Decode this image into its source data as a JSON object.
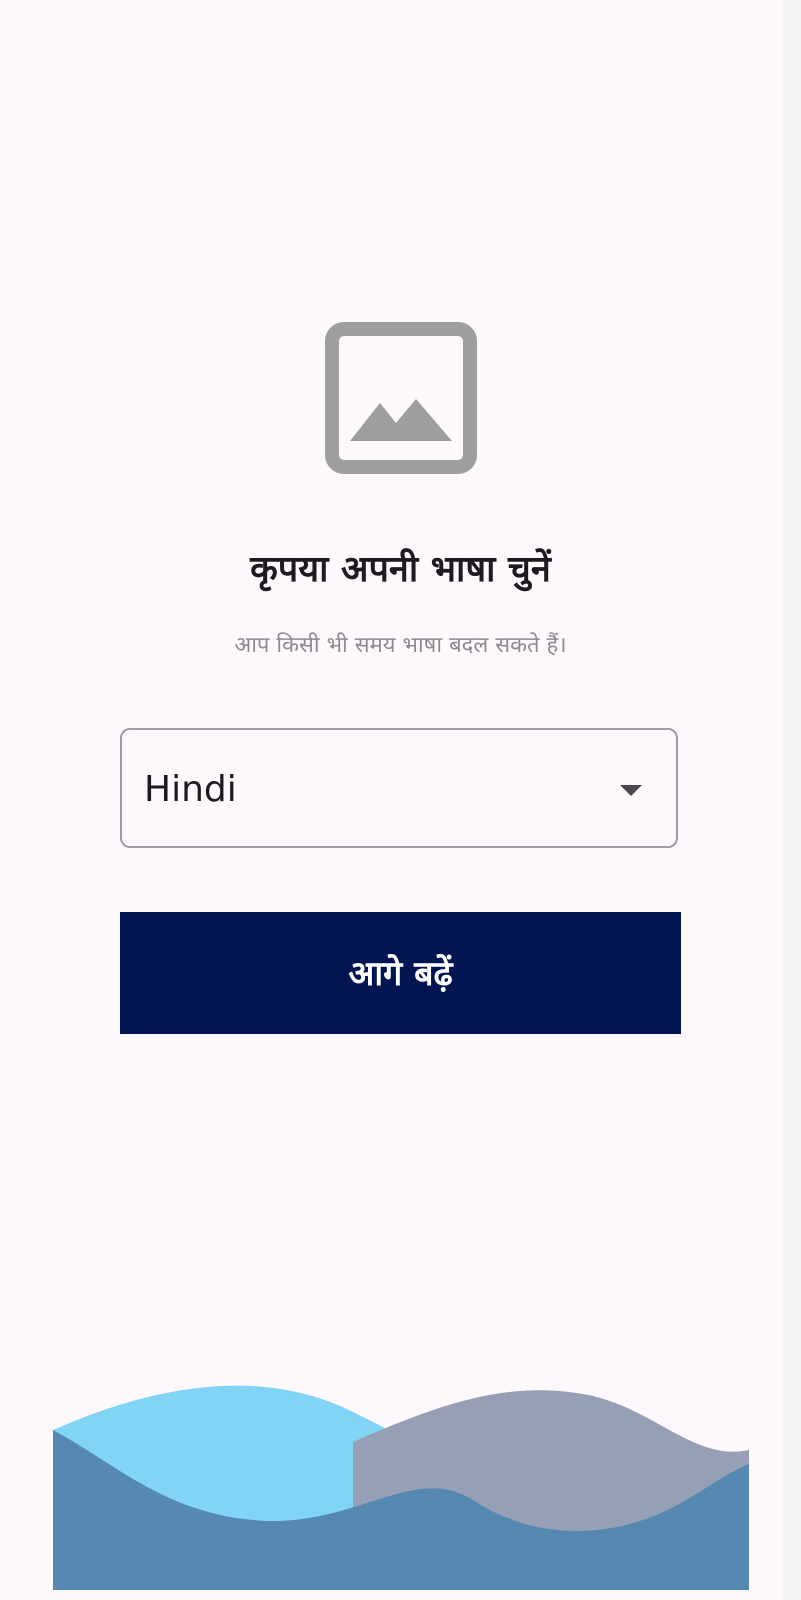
{
  "header": {
    "image_icon": "image-placeholder-icon",
    "title": "कृपया अपनी भाषा चुनें",
    "subtitle": "आप किसी भी समय भाषा बदल सकते हैं।"
  },
  "language_select": {
    "selected": "Hindi",
    "arrow_icon": "dropdown-arrow-icon"
  },
  "continue_button": {
    "label": "आगे बढ़ें"
  },
  "colors": {
    "background": "#fdf8fc",
    "button": "#001551",
    "icon_gray": "#9e9e9e",
    "wave_light_blue": "#82d4f5",
    "wave_gray": "#969fb6",
    "wave_dark_blue": "#5589b1"
  }
}
